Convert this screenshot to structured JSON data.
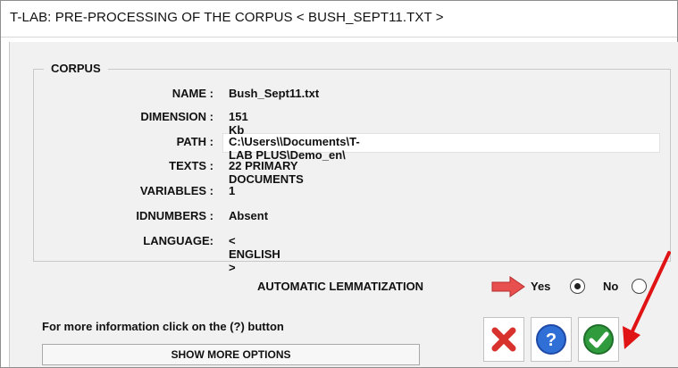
{
  "window": {
    "title": "T-LAB: PRE-PROCESSING OF THE CORPUS < BUSH_SEPT11.TXT >"
  },
  "corpus": {
    "group_title": "CORPUS",
    "fields": [
      {
        "label": "NAME :",
        "value": "Bush_Sept11.txt"
      },
      {
        "label": "DIMENSION :",
        "value": "151 Kb"
      },
      {
        "label": "PATH :",
        "value": "C:\\Users\\\\Documents\\T-LAB PLUS\\Demo_en\\"
      },
      {
        "label": "TEXTS :",
        "value": "22 PRIMARY DOCUMENTS"
      },
      {
        "label": "VARIABLES :",
        "value": "1"
      },
      {
        "label": "IDNUMBERS :",
        "value": "Absent"
      },
      {
        "label": "LANGUAGE:",
        "value": "< ENGLISH >"
      }
    ]
  },
  "lemmatization": {
    "label": "AUTOMATIC LEMMATIZATION",
    "yes_label": "Yes",
    "no_label": "No",
    "selected": "Yes"
  },
  "info_text": "For more information click on the (?) button",
  "more_options_label": "SHOW MORE OPTIONS",
  "icons": {
    "cancel": "close-icon",
    "help": "help-icon",
    "ok": "checkmark-icon",
    "arrow": "arrow-right-icon"
  },
  "colors": {
    "cancel_red": "#d8322d",
    "help_blue": "#2f6fd6",
    "ok_green": "#2f9b3d",
    "annotation_red": "#e01414",
    "arrow_red": "#e84f4f"
  }
}
